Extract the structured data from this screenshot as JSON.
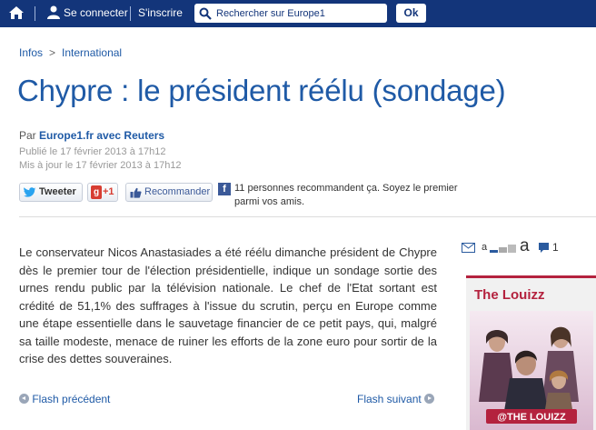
{
  "topbar": {
    "login_label": "Se connecter",
    "signup_label": "S'inscrire",
    "search_placeholder": "Rechercher sur Europe1",
    "ok_label": "Ok"
  },
  "breadcrumb": {
    "items": [
      "Infos",
      "International"
    ]
  },
  "article": {
    "title": "Chypre : le président réélu (sondage)",
    "byline_prefix": "Par",
    "byline_author": "Europe1.fr avec Reuters",
    "published": "Publié le 17 février 2013 à 17h12",
    "updated": "Mis à jour le 17 février 2013 à 17h12",
    "body": "Le conservateur Nicos Anastasiades a été réélu dimanche président de Chypre dès le premier tour de l'élection présidentielle, indique un sondage sortie des urnes rendu public par la télévision nationale. Le chef de l'Etat sortant est crédité de 51,1% des suffrages à l'issue du scrutin, perçu en Europe comme une étape essentielle dans le sauvetage financier de ce petit pays, qui, malgré sa taille modeste, menace de ruiner les efforts de la zone euro pour sortir de la crise des dettes souveraines."
  },
  "social": {
    "tweet_label": "Tweeter",
    "gplus_label": "+1",
    "recommend_label": "Recommander",
    "fb_text": "11 personnes recommandent ça. Soyez le premier parmi vos amis."
  },
  "tools": {
    "small_a": "a",
    "big_a": "a",
    "comments_count": "1"
  },
  "nav": {
    "prev_label": "Flash précédent",
    "next_label": "Flash suivant"
  },
  "sidebar": {
    "heading": "The Louizz",
    "poster_text": "@THE LOUIZZ"
  },
  "colors": {
    "topbar": "#13357a",
    "link": "#1f5aa6",
    "accent": "#b4223e"
  }
}
